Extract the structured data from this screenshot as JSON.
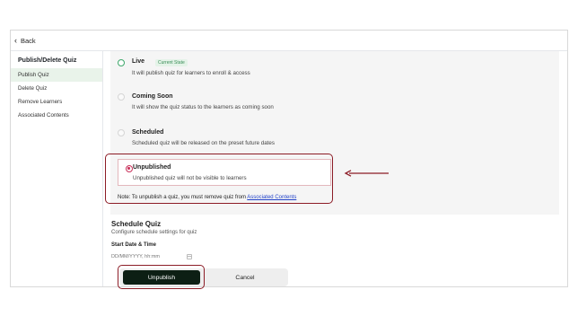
{
  "topbar": {
    "back_label": "Back",
    "back_icon": "chevron-left-icon"
  },
  "sidebar": {
    "title": "Publish/Delete Quiz",
    "items": [
      {
        "label": "Publish Quiz",
        "active": true
      },
      {
        "label": "Delete Quiz"
      },
      {
        "label": "Remove Learners"
      },
      {
        "label": "Associated Contents"
      }
    ]
  },
  "options": [
    {
      "title": "Live",
      "badge": "Current State",
      "desc": "It will publish quiz for learners to enroll & access",
      "state": "current"
    },
    {
      "title": "Coming Soon",
      "desc": "It will show the quiz status to the learners as coming soon",
      "state": "disabled"
    },
    {
      "title": "Scheduled",
      "desc": "Scheduled quiz will be released on the preset future dates",
      "state": "disabled"
    },
    {
      "title": "Unpublished",
      "desc": "Unpublished quiz will not be visible to learners",
      "state": "selected"
    }
  ],
  "note": {
    "text": "Note: To unpublish a quiz, you must remove quiz from ",
    "link": "Associated Contents"
  },
  "schedule": {
    "title": "Schedule Quiz",
    "subtitle": "Configure schedule settings for quiz",
    "date_label": "Start Date & Time",
    "date_placeholder": "DD/MM/YYYY, hh:mm"
  },
  "buttons": {
    "primary": "Unpublish",
    "secondary": "Cancel"
  },
  "colors": {
    "accent_dark": "#0d1f14",
    "selected": "#c9325b",
    "live": "#3ea86b",
    "annotation": "#8c1c26",
    "link": "#2343c9"
  }
}
